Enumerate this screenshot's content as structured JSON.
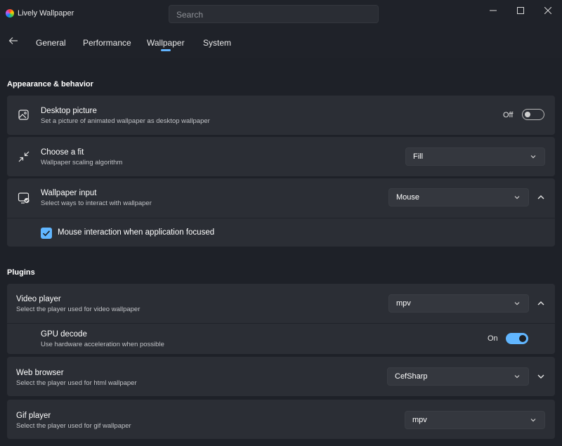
{
  "app": {
    "title": "Lively Wallpaper"
  },
  "search": {
    "placeholder": "Search"
  },
  "tabs": [
    {
      "label": "General"
    },
    {
      "label": "Performance"
    },
    {
      "label": "Wallpaper"
    },
    {
      "label": "System"
    }
  ],
  "active_tab": "Wallpaper",
  "colors": {
    "accent": "#61b6ff",
    "card": "#2b2e35",
    "background": "#1e2128"
  },
  "appearance": {
    "title": "Appearance & behavior",
    "desktop_picture": {
      "title": "Desktop picture",
      "subtitle": "Set a picture of animated wallpaper as desktop wallpaper",
      "toggle_label": "Off",
      "icon": "image-icon"
    },
    "choose_fit": {
      "title": "Choose a fit",
      "subtitle": "Wallpaper scaling algorithm",
      "selected": "Fill",
      "icon": "shrink-icon"
    },
    "wallpaper_input": {
      "title": "Wallpaper input",
      "subtitle": "Select ways to interact with wallpaper",
      "selected": "Mouse",
      "icon": "screen-check-icon",
      "checkbox_label": "Mouse interaction when application focused"
    }
  },
  "plugins": {
    "title": "Plugins",
    "video_player": {
      "title": "Video player",
      "subtitle": "Select the player used for video wallpaper",
      "selected": "mpv"
    },
    "gpu_decode": {
      "title": "GPU decode",
      "subtitle": "Use hardware acceleration when possible",
      "toggle_label": "On"
    },
    "web_browser": {
      "title": "Web browser",
      "subtitle": "Select the player used for html wallpaper",
      "selected": "CefSharp"
    },
    "gif_player": {
      "title": "Gif player",
      "subtitle": "Select the player used for gif wallpaper",
      "selected": "mpv"
    }
  }
}
